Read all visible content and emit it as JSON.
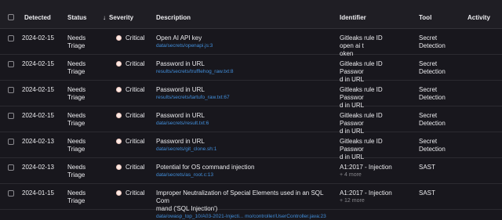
{
  "headers": {
    "detected": "Detected",
    "status": "Status",
    "sort_arrow": "↓",
    "severity": "Severity",
    "description": "Description",
    "identifier": "Identifier",
    "tool": "Tool",
    "activity": "Activity"
  },
  "rows": [
    {
      "detected": "2024-02-15",
      "status_line1": "Needs",
      "status_line2": "Triage",
      "severity": "Critical",
      "title_line1": "Open AI API key",
      "title_line2": "",
      "path": "data/secrets/openapi.js:3",
      "id_line1": "Gitleaks rule ID open ai t",
      "id_line2": "oken",
      "more": "",
      "tool_line1": "Secret",
      "tool_line2": "Detection"
    },
    {
      "detected": "2024-02-15",
      "status_line1": "Needs",
      "status_line2": "Triage",
      "severity": "Critical",
      "title_line1": "Password in URL",
      "title_line2": "",
      "path": "results/secrets/trufflehog_raw.txt:8",
      "id_line1": "Gitleaks rule ID Passwor",
      "id_line2": "d in URL",
      "more": "",
      "tool_line1": "Secret",
      "tool_line2": "Detection"
    },
    {
      "detected": "2024-02-15",
      "status_line1": "Needs",
      "status_line2": "Triage",
      "severity": "Critical",
      "title_line1": "Password in URL",
      "title_line2": "",
      "path": "results/secrets/tartufo_raw.txt:67",
      "id_line1": "Gitleaks rule ID Passwor",
      "id_line2": "d in URL",
      "more": "",
      "tool_line1": "Secret",
      "tool_line2": "Detection"
    },
    {
      "detected": "2024-02-15",
      "status_line1": "Needs",
      "status_line2": "Triage",
      "severity": "Critical",
      "title_line1": "Password in URL",
      "title_line2": "",
      "path": "data/secrets/result.txt:6",
      "id_line1": "Gitleaks rule ID Passwor",
      "id_line2": "d in URL",
      "more": "",
      "tool_line1": "Secret",
      "tool_line2": "Detection"
    },
    {
      "detected": "2024-02-13",
      "status_line1": "Needs",
      "status_line2": "Triage",
      "severity": "Critical",
      "title_line1": "Password in URL",
      "title_line2": "",
      "path": "data/secrets/git_clone.sh:1",
      "id_line1": "Gitleaks rule ID Passwor",
      "id_line2": "d in URL",
      "more": "",
      "tool_line1": "Secret",
      "tool_line2": "Detection"
    },
    {
      "detected": "2024-02-13",
      "status_line1": "Needs",
      "status_line2": "Triage",
      "severity": "Critical",
      "title_line1": "Potential for OS command injection",
      "title_line2": "",
      "path": "data/secrets/as_root.c:13",
      "id_line1": "A1:2017 - Injection",
      "id_line2": "",
      "more": "+ 4 more",
      "tool_line1": "SAST",
      "tool_line2": ""
    },
    {
      "detected": "2024-01-15",
      "status_line1": "Needs",
      "status_line2": "Triage",
      "severity": "Critical",
      "title_line1": "Improper Neutralization of Special Elements used in an SQL Com",
      "title_line2": "mand ('SQL Injection')",
      "path": "data/owasp_top_10/A03-2021-Injecti...   mo/controller/UserController.java:23",
      "id_line1": "A1:2017 - Injection",
      "id_line2": "",
      "more": "+ 12 more",
      "tool_line1": "SAST",
      "tool_line2": ""
    }
  ],
  "colors": {
    "link": "#428fdc",
    "critical_dot": "#fbe9e4",
    "background": "#18171d"
  }
}
